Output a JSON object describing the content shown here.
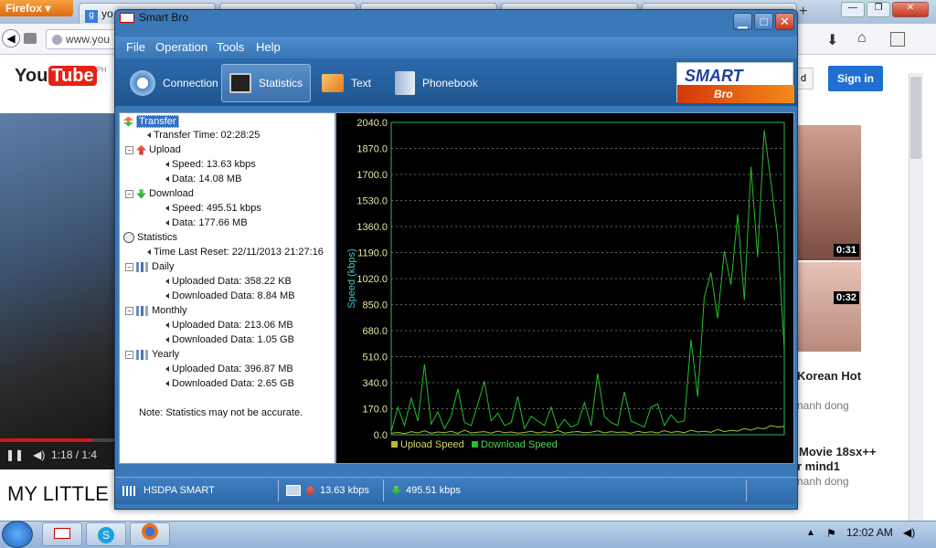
{
  "browser": {
    "menu_label": "Firefox",
    "tabs": [
      {
        "label": "yo"
      },
      {
        "label": ""
      },
      {
        "label": ""
      },
      {
        "label": ""
      },
      {
        "label": ""
      }
    ],
    "url": "www.you"
  },
  "youtube": {
    "logo": "You",
    "logo_tube": "Tube",
    "logo_region": "PH",
    "signin": "Sign in",
    "video_time": "1:18 / 1:4",
    "video_title": "MY LITTLE",
    "thumb1_duration": "0:31",
    "thumb2_duration": "0:32",
    "side1_title": "Korean Hot",
    "side1_sub": "nanh dong",
    "side2_title": "Movie 18sx++",
    "side2_title2": "r mind1",
    "side2_sub": "nanh dong"
  },
  "taskbar": {
    "clock": "12:02 AM"
  },
  "window": {
    "title": "Smart Bro",
    "menu": {
      "file": "File",
      "operation": "Operation",
      "tools": "Tools",
      "help": "Help"
    },
    "toolbar": {
      "connection": "Connection",
      "statistics": "Statistics",
      "text": "Text",
      "phonebook": "Phonebook"
    },
    "logo_top": "SMART",
    "logo_bottom": "Bro"
  },
  "tree": {
    "transfer": "Transfer",
    "transfer_time": "Transfer Time: 02:28:25",
    "upload": "Upload",
    "upload_speed": "Speed: 13.63 kbps",
    "upload_data": "Data: 14.08 MB",
    "download": "Download",
    "download_speed": "Speed: 495.51 kbps",
    "download_data": "Data: 177.66 MB",
    "statistics": "Statistics",
    "time_last_reset": "Time Last Reset: 22/11/2013 21:27:16",
    "daily": "Daily",
    "daily_up": "Uploaded Data: 358.22 KB",
    "daily_down": "Downloaded Data: 8.84 MB",
    "monthly": "Monthly",
    "monthly_up": "Uploaded Data: 213.06 MB",
    "monthly_down": "Downloaded Data: 1.05 GB",
    "yearly": "Yearly",
    "yearly_up": "Uploaded Data: 396.87 MB",
    "yearly_down": "Downloaded Data: 2.65 GB",
    "note": "Note: Statistics may not be accurate."
  },
  "chart_data": {
    "type": "line",
    "ylabel": "Speed (kbps)",
    "ylim": [
      0,
      2040
    ],
    "yticks": [
      "2040.0",
      "1870.0",
      "1700.0",
      "1530.0",
      "1360.0",
      "1190.0",
      "1020.0",
      "850.0",
      "680.0",
      "510.0",
      "340.0",
      "170.0",
      "0.0"
    ],
    "grid": true,
    "legend": "bottom",
    "colors": {
      "upload": "#b8b830",
      "download": "#22c02a"
    },
    "series": [
      {
        "name": "Upload Speed",
        "values": [
          10,
          15,
          8,
          20,
          12,
          25,
          10,
          18,
          14,
          22,
          9,
          30,
          12,
          16,
          20,
          11,
          24,
          13,
          18,
          10,
          15,
          22,
          12,
          19,
          14,
          28,
          11,
          17,
          21,
          13,
          16,
          25,
          12,
          20,
          15,
          18,
          10,
          23,
          14,
          19,
          12,
          26,
          15,
          21,
          13,
          30,
          18,
          22,
          16,
          35,
          20,
          28,
          24,
          40,
          30,
          45,
          38,
          60,
          50,
          55
        ]
      },
      {
        "name": "Download Speed",
        "values": [
          20,
          180,
          60,
          240,
          90,
          460,
          70,
          150,
          40,
          120,
          300,
          80,
          60,
          200,
          350,
          90,
          140,
          60,
          80,
          250,
          40,
          120,
          90,
          60,
          180,
          40,
          100,
          50,
          70,
          210,
          60,
          400,
          120,
          80,
          60,
          280,
          90,
          70,
          50,
          180,
          200,
          60,
          130,
          80,
          90,
          620,
          250,
          900,
          1060,
          760,
          1200,
          980,
          1440,
          880,
          1750,
          1160,
          1990,
          1650,
          1300,
          560
        ]
      }
    ]
  },
  "status": {
    "network": "HSDPA SMART",
    "up_speed": "13.63 kbps",
    "down_speed": "495.51 kbps"
  }
}
